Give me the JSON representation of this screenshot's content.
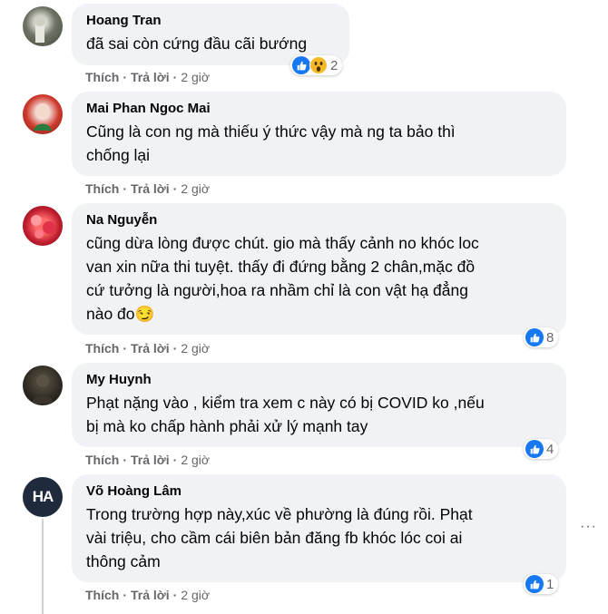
{
  "comments": [
    {
      "author": "Hoang Tran",
      "text": "đã sai còn cứng đầu cãi bướng",
      "like_label": "Thích",
      "reply_label": "Trả lời",
      "time": "2 giờ",
      "reaction_count": "2",
      "reactions": [
        "like-icon",
        "wow-icon"
      ]
    },
    {
      "author": "Mai Phan Ngoc Mai",
      "text": "Cũng là con ng mà thiếu ý thức vậy mà ng ta bảo thì\nchống lại",
      "like_label": "Thích",
      "reply_label": "Trả lời",
      "time": "2 giờ"
    },
    {
      "author": "Na Nguyễn",
      "text": "cũng dừa lòng được chút. gio mà thấy cảnh no khóc loc\nvan xin nữa thi tuyệt. thấy đi đứng bằng 2 chân,mặc đồ\ncứ tưởng là người,hoa ra nhầm chỉ là con vật hạ đẳng\nnào đo😏",
      "like_label": "Thích",
      "reply_label": "Trả lời",
      "time": "2 giờ",
      "reaction_count": "8",
      "reactions": [
        "like-icon"
      ]
    },
    {
      "author": "My Huynh",
      "text": "Phạt nặng vào , kiểm tra xem c này có bị COVID ko ,nếu\nbị mà ko chấp hành phải xử lý mạnh tay",
      "like_label": "Thích",
      "reply_label": "Trả lời",
      "time": "2 giờ",
      "reaction_count": "4",
      "reactions": [
        "like-icon"
      ]
    },
    {
      "author": "Võ Hoàng Lâm",
      "text": "Trong trường hợp này,xúc về phường là đúng rồi. Phạt\nvài triệu, cho cầm cái biên bản đăng fb khóc lóc coi ai\nthông cảm",
      "like_label": "Thích",
      "reply_label": "Trả lời",
      "time": "2 giờ",
      "reaction_count": "1",
      "reactions": [
        "like-icon"
      ],
      "avatar_text": "HA"
    }
  ],
  "separator": "·",
  "more_glyph": "···",
  "colors": {
    "bubble": "#f0f2f5",
    "like_blue": "#1877f2",
    "meta_gray": "#65676b",
    "wow_yellow": "#f7b928"
  }
}
